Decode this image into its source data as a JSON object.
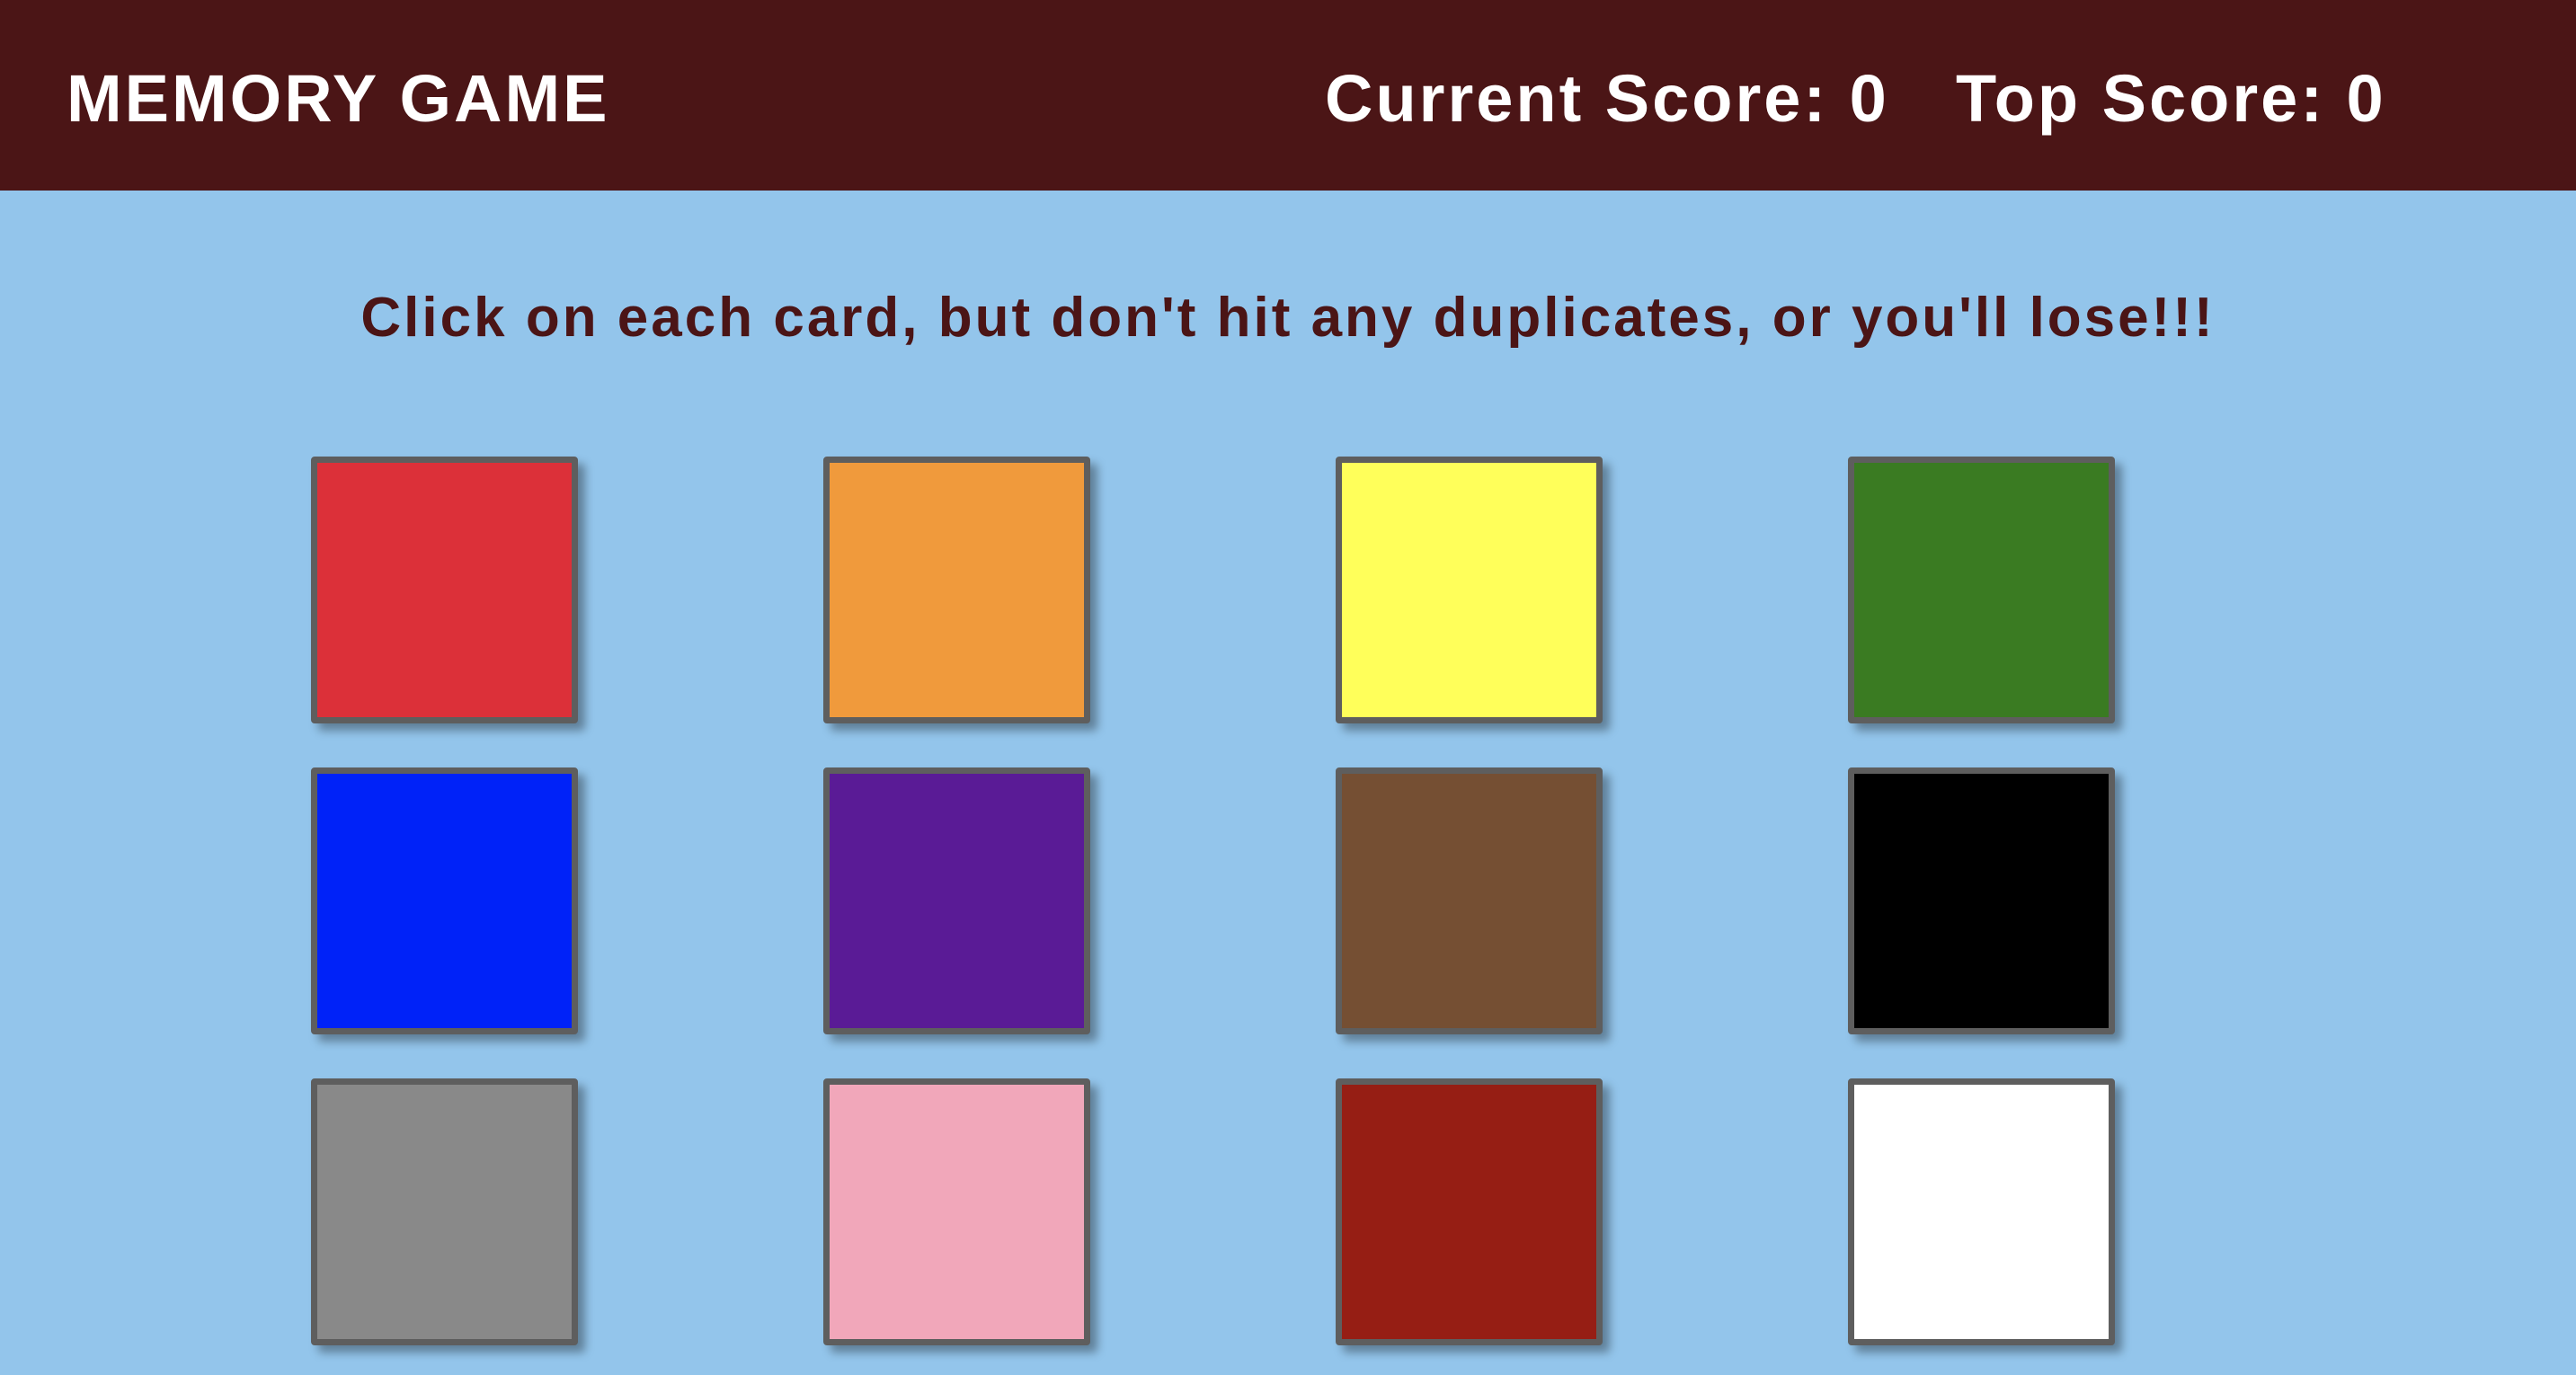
{
  "navbar": {
    "title": "MEMORY GAME",
    "current_score_label": "Current Score: 0",
    "top_score_label": "Top Score: 0"
  },
  "instructions": "Click on each card, but don't hit any duplicates, or you'll lose!!!",
  "cards": [
    {
      "color": "#dc3039",
      "name": "red"
    },
    {
      "color": "#f09a3c",
      "name": "orange"
    },
    {
      "color": "#ffff5a",
      "name": "yellow"
    },
    {
      "color": "#3a7b22",
      "name": "green"
    },
    {
      "color": "#0022f8",
      "name": "blue"
    },
    {
      "color": "#5a1b96",
      "name": "purple"
    },
    {
      "color": "#754f33",
      "name": "brown"
    },
    {
      "color": "#000000",
      "name": "black"
    },
    {
      "color": "#898989",
      "name": "gray"
    },
    {
      "color": "#f1a7ba",
      "name": "pink"
    },
    {
      "color": "#961e14",
      "name": "maroon"
    },
    {
      "color": "#ffffff",
      "name": "white"
    }
  ]
}
